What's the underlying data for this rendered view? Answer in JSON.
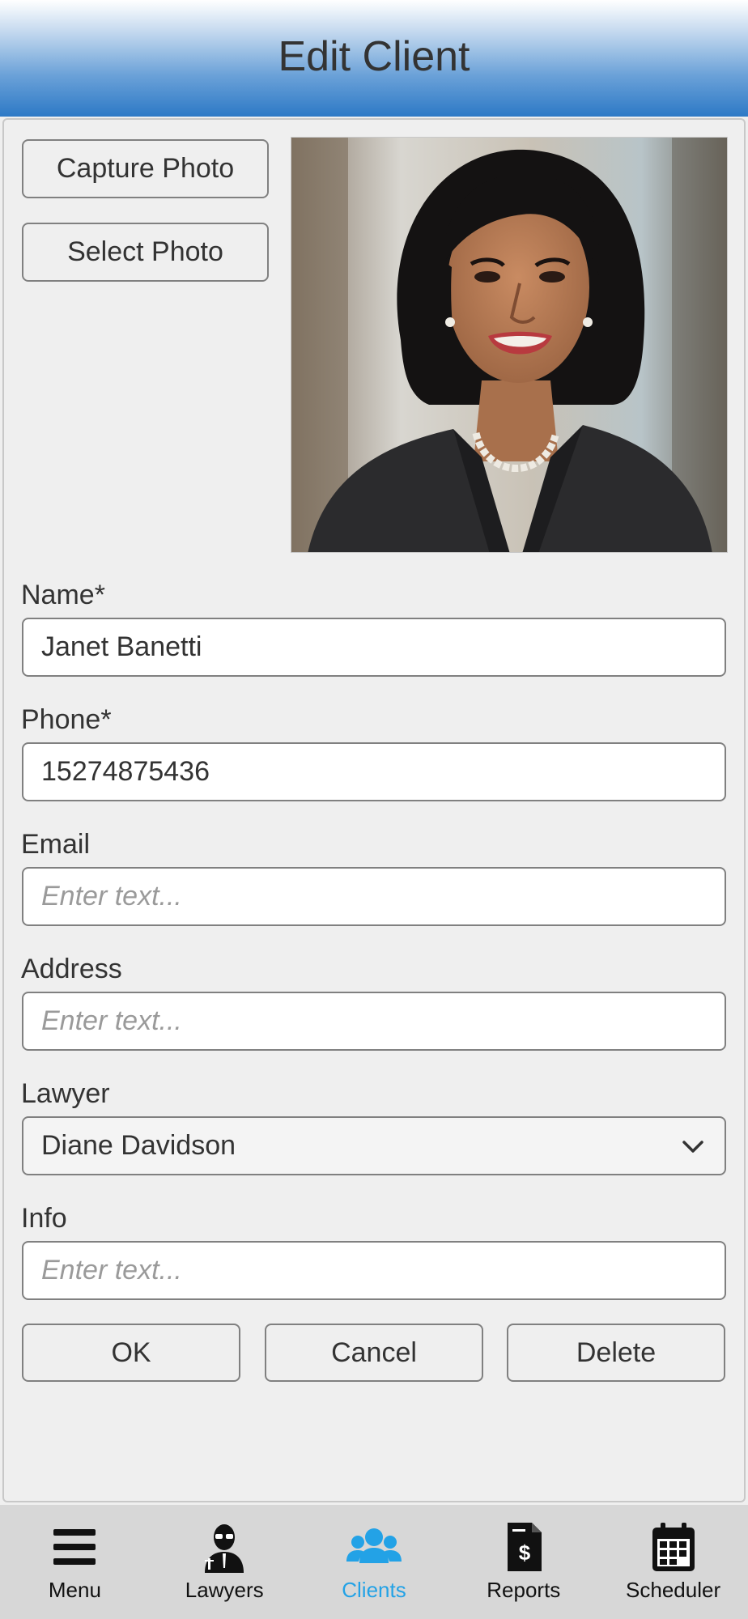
{
  "header": {
    "title": "Edit Client"
  },
  "photo_actions": {
    "capture_label": "Capture Photo",
    "select_label": "Select Photo"
  },
  "form": {
    "name": {
      "label": "Name*",
      "value": "Janet Banetti"
    },
    "phone": {
      "label": "Phone*",
      "value": "15274875436"
    },
    "email": {
      "label": "Email",
      "value": "",
      "placeholder": "Enter text..."
    },
    "address": {
      "label": "Address",
      "value": "",
      "placeholder": "Enter text..."
    },
    "lawyer": {
      "label": "Lawyer",
      "selected": "Diane Davidson"
    },
    "info": {
      "label": "Info",
      "value": "",
      "placeholder": "Enter text..."
    }
  },
  "actions": {
    "ok_label": "OK",
    "cancel_label": "Cancel",
    "delete_label": "Delete"
  },
  "nav": {
    "items": [
      {
        "label": "Menu",
        "icon": "hamburger-icon"
      },
      {
        "label": "Lawyers",
        "icon": "lawyer-icon"
      },
      {
        "label": "Clients",
        "icon": "clients-icon",
        "active": true
      },
      {
        "label": "Reports",
        "icon": "report-icon"
      },
      {
        "label": "Scheduler",
        "icon": "calendar-icon"
      }
    ],
    "active_color": "#23a2e6"
  }
}
